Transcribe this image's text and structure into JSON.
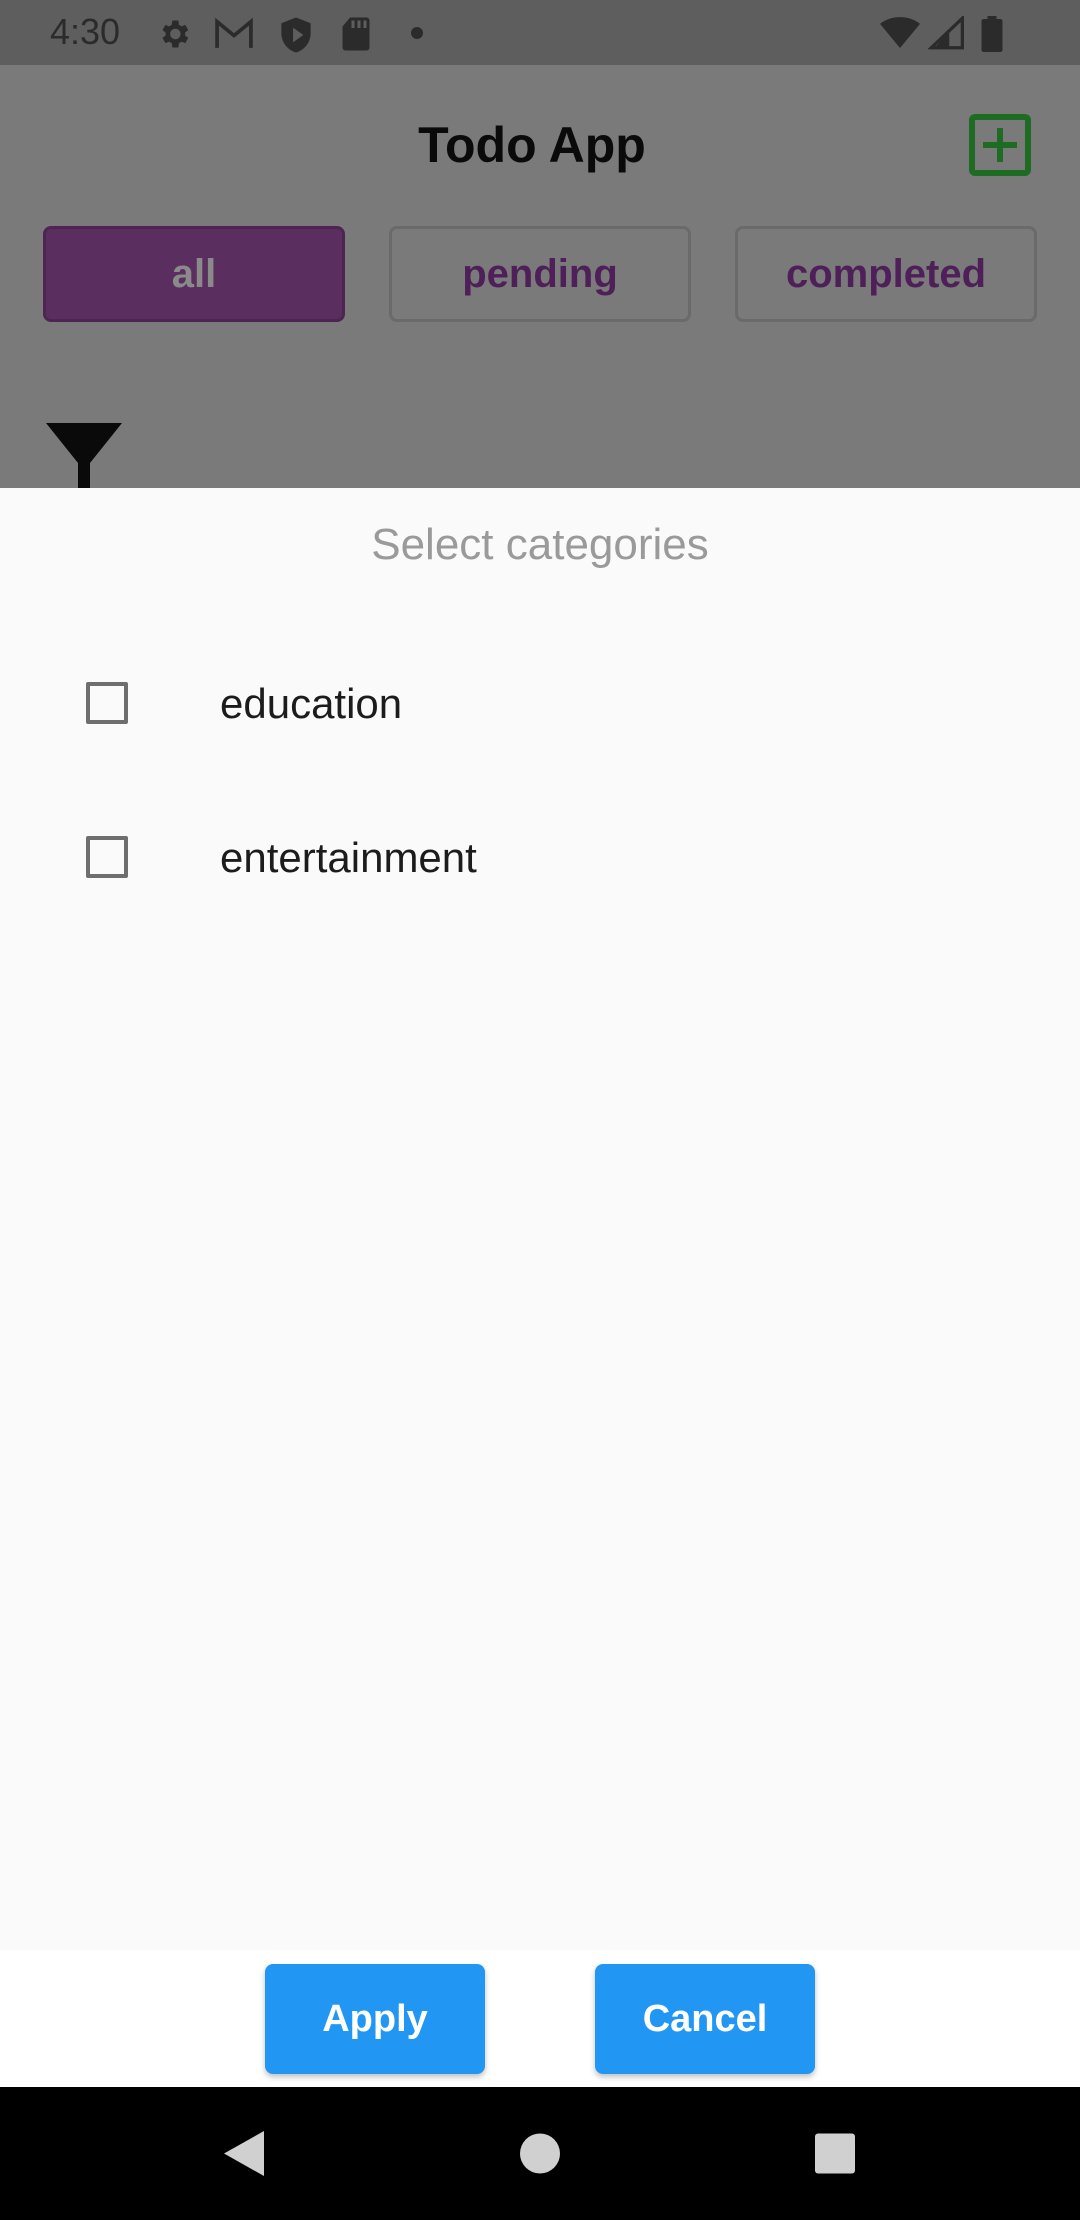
{
  "status_bar": {
    "time": "4:30",
    "icons": [
      "settings-icon",
      "gmail-icon",
      "shield-play-icon",
      "sd-card-icon",
      "dot-icon",
      "wifi-icon",
      "signal-icon",
      "battery-icon"
    ]
  },
  "app": {
    "title": "Todo App",
    "add_icon": "add-box-icon",
    "filter_tabs": [
      {
        "label": "all",
        "active": true
      },
      {
        "label": "pending",
        "active": false
      },
      {
        "label": "completed",
        "active": false
      }
    ],
    "filter_icon": "funnel-icon"
  },
  "dialog": {
    "title": "Select categories",
    "categories": [
      {
        "label": "education",
        "checked": false
      },
      {
        "label": "entertainment",
        "checked": false
      }
    ],
    "apply_label": "Apply",
    "cancel_label": "Cancel"
  },
  "colors": {
    "accent_purple": "#5a2e5f",
    "button_blue": "#2196f3",
    "add_icon_green": "#1e6b22"
  },
  "nav_bar": {
    "buttons": [
      "back-icon",
      "home-icon",
      "recents-icon"
    ]
  }
}
